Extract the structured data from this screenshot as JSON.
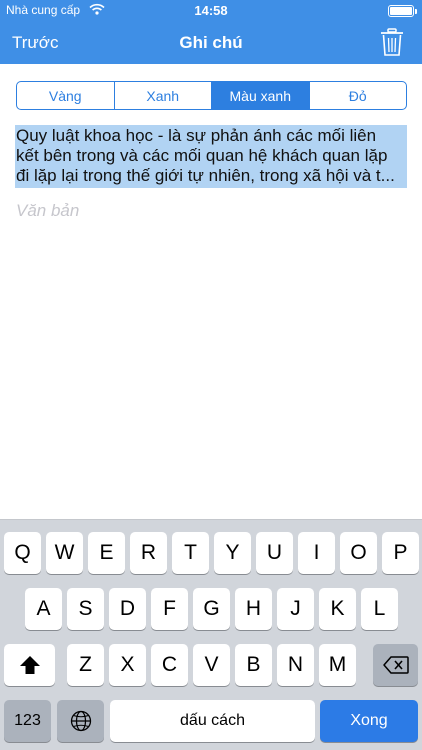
{
  "status_bar": {
    "carrier": "Nhà cung cấp",
    "time": "14:58",
    "battery_level": 1.0,
    "wifi_icon": "wifi-icon",
    "battery_icon": "battery-icon"
  },
  "nav": {
    "back_label": "Trước",
    "title": "Ghi chú",
    "trash_icon": "trash-icon"
  },
  "segments": [
    "Vàng",
    "Xanh",
    "Màu xanh",
    "Đỏ"
  ],
  "selected_segment": "Màu xanh",
  "note": {
    "lines": [
      "Quy luật khoa học -  là sự phản ánh các mối liên",
      "kết bên trong và các mối quan hệ khách quan lặp",
      "đi lặp lại trong thế giới tự nhiên, trong xã hội và t..."
    ],
    "placeholder": "Văn bản"
  },
  "keyboard": {
    "row1": [
      "Q",
      "W",
      "E",
      "R",
      "T",
      "Y",
      "U",
      "I",
      "O",
      "P"
    ],
    "row2": [
      "A",
      "S",
      "D",
      "F",
      "G",
      "H",
      "J",
      "K",
      "L"
    ],
    "row3": [
      "Z",
      "X",
      "C",
      "V",
      "B",
      "N",
      "M"
    ],
    "numbers_label": "123",
    "space_label": "dấu cách",
    "return_label": "Xong",
    "shift_icon": "shift-icon",
    "globe_icon": "globe-icon",
    "delete_icon": "delete-icon"
  },
  "colors": {
    "nav_background": "#3f8fe6",
    "accent": "#2d7fe0",
    "selection": "#b1d3f3",
    "keyboard_background": "#d1d5db",
    "return_key": "#2c7be6"
  }
}
